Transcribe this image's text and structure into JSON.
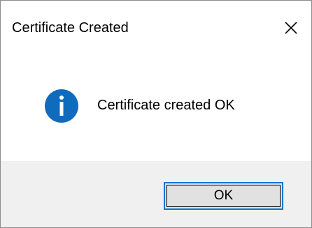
{
  "window": {
    "title": "Certificate Created",
    "close_icon": "close-icon"
  },
  "message": {
    "icon": "info-icon",
    "text": "Certificate created OK"
  },
  "buttons": {
    "ok_label": "OK"
  },
  "colors": {
    "accent": "#0078d7",
    "footer_bg": "#f0f0f0",
    "button_bg": "#e1e1e1",
    "icon_blue": "#0f6cbd"
  }
}
